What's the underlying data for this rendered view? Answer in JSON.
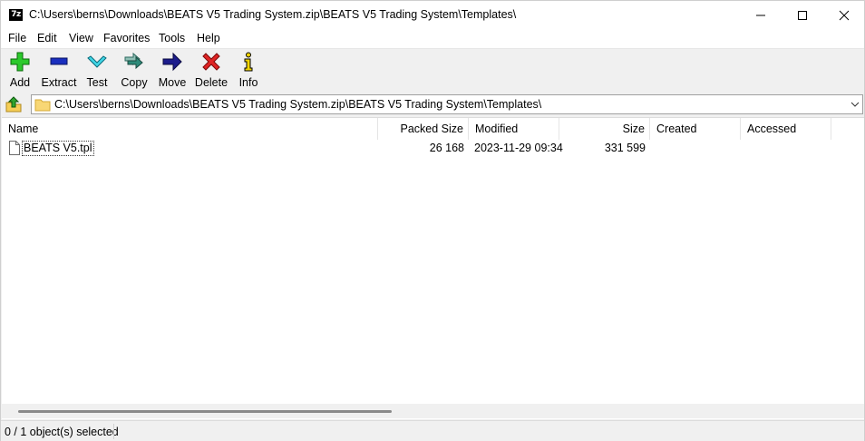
{
  "window": {
    "title": "C:\\Users\\berns\\Downloads\\BEATS V5 Trading System.zip\\BEATS V5 Trading System\\Templates\\",
    "app_icon_text": "7z",
    "controls": [
      "minimize-icon",
      "maximize-icon",
      "close-icon"
    ]
  },
  "menu": [
    {
      "label": "File"
    },
    {
      "label": "Edit"
    },
    {
      "label": "View"
    },
    {
      "label": "Favorites"
    },
    {
      "label": "Tools"
    },
    {
      "label": "Help"
    }
  ],
  "toolbar": [
    {
      "label": "Add",
      "icon": "plus-icon",
      "color": "#22b022"
    },
    {
      "label": "Extract",
      "icon": "minus-icon",
      "color": "#1a2fbf"
    },
    {
      "label": "Test",
      "icon": "checkmark-icon",
      "color": "#36c9d8"
    },
    {
      "label": "Copy",
      "icon": "double-arrow-icon",
      "color": "#2e8b7a"
    },
    {
      "label": "Move",
      "icon": "arrow-right-icon",
      "color": "#1c1c8c"
    },
    {
      "label": "Delete",
      "icon": "x-icon",
      "color": "#d42020"
    },
    {
      "label": "Info",
      "icon": "info-icon",
      "color": "#e8c800"
    }
  ],
  "address": {
    "path": "C:\\Users\\berns\\Downloads\\BEATS V5 Trading System.zip\\BEATS V5 Trading System\\Templates\\"
  },
  "columns": {
    "name": "Name",
    "packed_size": "Packed Size",
    "modified": "Modified",
    "size": "Size",
    "created": "Created",
    "accessed": "Accessed"
  },
  "files": [
    {
      "name": "BEATS V5.tpl",
      "packed_size": "26 168",
      "modified": "2023-11-29 09:34",
      "size": "331 599",
      "created": "",
      "accessed": ""
    }
  ],
  "status": {
    "selection": "0 / 1 object(s) selected"
  }
}
